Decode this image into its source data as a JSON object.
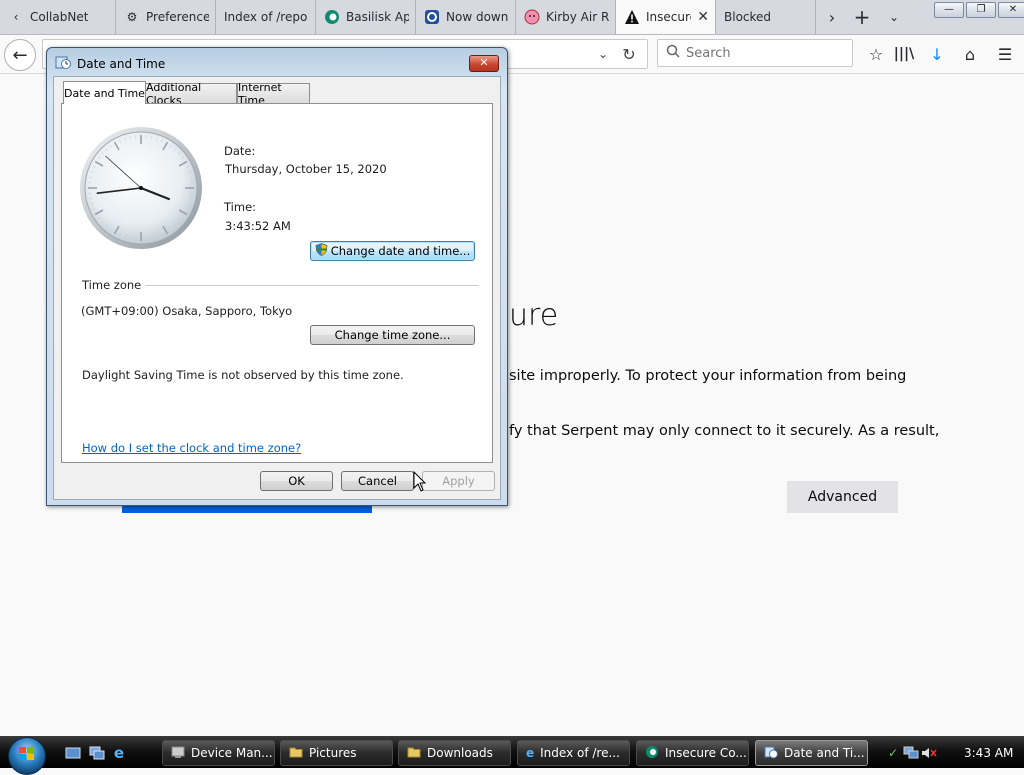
{
  "browser": {
    "tabs": [
      {
        "title": "CollabNet",
        "icon": "chevron-left-icon"
      },
      {
        "title": "Preferences",
        "icon": "gear-icon"
      },
      {
        "title": "Index of /repo",
        "icon": ""
      },
      {
        "title": "Basilisk Ap",
        "icon": "basilisk-icon"
      },
      {
        "title": "Now down",
        "icon": "circle-icon"
      },
      {
        "title": "Kirby Air R",
        "icon": "kirby-icon"
      },
      {
        "title": "Insecure",
        "icon": "warning-icon",
        "active": true
      },
      {
        "title": "Blocked",
        "icon": ""
      }
    ],
    "search_placeholder": "Search"
  },
  "page": {
    "heading": "ure",
    "line1": "site improperly. To protect your information from being",
    "line2": "fy that Serpent may only connect to it securely. As a result,",
    "advanced_label": "Advanced"
  },
  "dialog": {
    "title": "Date and Time",
    "tabs": [
      "Date and Time",
      "Additional Clocks",
      "Internet Time"
    ],
    "date_label": "Date:",
    "date_value": "Thursday, October 15, 2020",
    "time_label": "Time:",
    "time_value": "3:43:52 AM",
    "clock": {
      "hour": 3,
      "minute": 43,
      "second": 52
    },
    "change_datetime_label": "Change date and time...",
    "timezone_heading": "Time zone",
    "timezone_value": "(GMT+09:00) Osaka, Sapporo, Tokyo",
    "change_timezone_label": "Change time zone...",
    "dst_note": "Daylight Saving Time is not observed by this time zone.",
    "help_link": "How do I set the clock and time zone?",
    "ok_label": "OK",
    "cancel_label": "Cancel",
    "apply_label": "Apply"
  },
  "taskbar": {
    "items": [
      {
        "label": "Device Man...",
        "icon": "device-manager-icon"
      },
      {
        "label": "Pictures",
        "icon": "folder-icon"
      },
      {
        "label": "Downloads",
        "icon": "folder-icon"
      },
      {
        "label": "Index of /re...",
        "icon": "ie-icon"
      },
      {
        "label": "Insecure Co...",
        "icon": "serpent-icon"
      },
      {
        "label": "Date and Ti...",
        "icon": "clock-icon",
        "active": true
      }
    ],
    "clock": "3:43 AM"
  }
}
